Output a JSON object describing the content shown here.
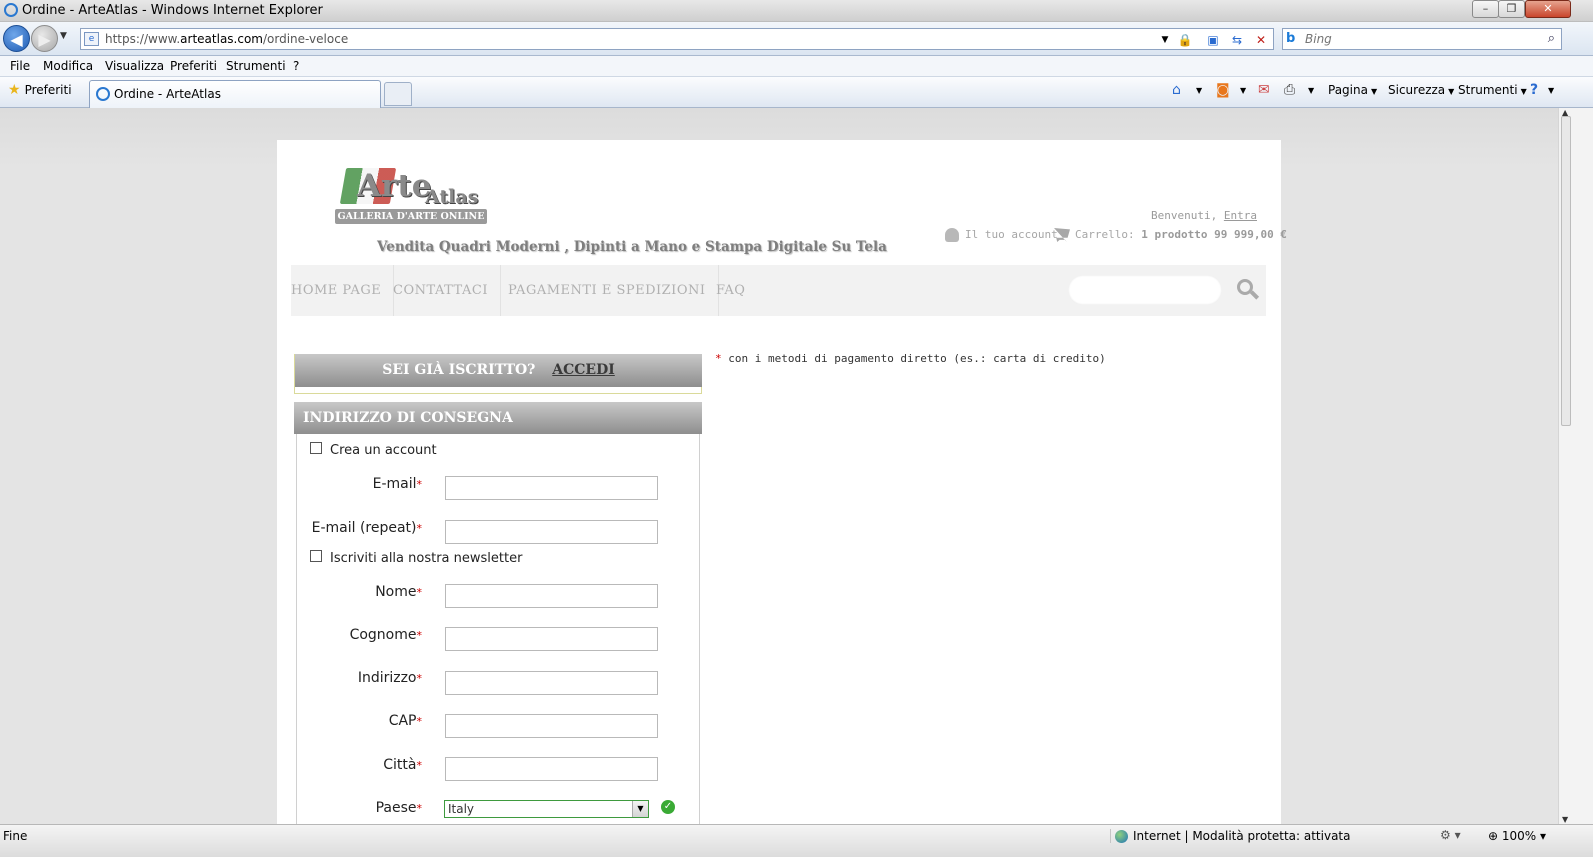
{
  "window": {
    "title": "Ordine - ArteAtlas - Windows Internet Explorer"
  },
  "address": {
    "scheme": "https://www.",
    "host": "arteatlas.com",
    "path": "/ordine-veloce"
  },
  "search": {
    "placeholder": "Bing"
  },
  "menu": [
    "File",
    "Modifica",
    "Visualizza",
    "Preferiti",
    "Strumenti",
    "?"
  ],
  "favorites": {
    "label": "Preferiti"
  },
  "tab": {
    "label": "Ordine - ArteAtlas"
  },
  "commandbar": {
    "page": "Pagina",
    "security": "Sicurezza",
    "tools": "Strumenti"
  },
  "site": {
    "logo": {
      "arte": "Arte",
      "atlas": "Atlas",
      "subtitle": "GALLERIA D'ARTE ONLINE"
    },
    "tagline": "Vendita Quadri Moderni , Dipinti a Mano e Stampa Digitale Su Tela",
    "welcome": "Benvenuti,",
    "login_link": "Entra",
    "account": "Il tuo account",
    "cart_label": "Carrello:",
    "cart_value": "1 prodotto 99 999,00 €",
    "nav": [
      "HOME PAGE",
      "CONTATTACI",
      "PAGAMENTI E SPEDIZIONI",
      "FAQ"
    ]
  },
  "checkout": {
    "login_prompt": "SEI GIÀ ISCRITTO?",
    "login_action": "ACCEDI",
    "delivery_title": "INDIRIZZO DI CONSEGNA",
    "create_account": "Crea un account",
    "newsletter": "Iscriviti alla nostra newsletter",
    "required_mark": "*",
    "fields": {
      "email": "E-mail",
      "email_repeat": "E-mail (repeat)",
      "nome": "Nome",
      "cognome": "Cognome",
      "indirizzo": "Indirizzo",
      "cap": "CAP",
      "citta": "Città",
      "paese": "Paese"
    },
    "country_value": "Italy",
    "payment_note": "con i metodi di pagamento diretto (es.: carta di credito)"
  },
  "status": {
    "text": "Fine",
    "zone": "Internet | Modalità protetta: attivata",
    "zoom": "100%"
  }
}
